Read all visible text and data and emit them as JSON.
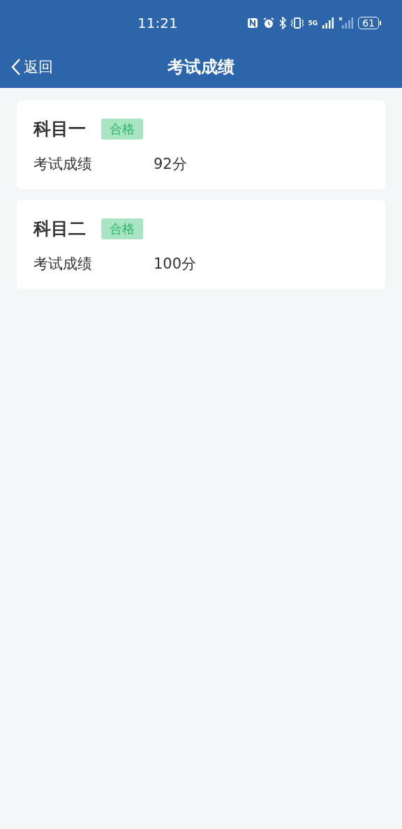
{
  "status_bar": {
    "time": "11:21",
    "network": "5G",
    "battery": "61"
  },
  "nav_bar": {
    "back": "返回",
    "title": "考试成绩"
  },
  "subjects": [
    {
      "name": "科目一",
      "status": "合格",
      "passed": true,
      "score_label": "考试成绩",
      "score": "92分"
    },
    {
      "name": "科目二",
      "status": "合格",
      "passed": true,
      "score_label": "考试成绩",
      "score": "100分"
    }
  ]
}
